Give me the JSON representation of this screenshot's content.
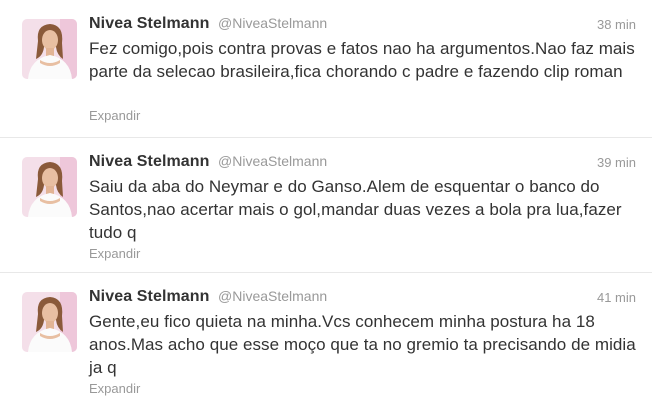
{
  "tweets": [
    {
      "name": "Nivea Stelmann",
      "handle": "@NiveaStelmann",
      "time": "38 min",
      "text": "Fez comigo,pois contra provas e fatos nao ha argumentos.Nao faz mais parte da selecao brasileira,fica chorando c padre e fazendo clip roman",
      "expand": "Expandir"
    },
    {
      "name": "Nivea Stelmann",
      "handle": "@NiveaStelmann",
      "time": "39 min",
      "text": "Saiu da aba do Neymar e do Ganso.Alem de esquentar o banco do Santos,nao acertar mais o gol,mandar duas vezes a bola pra lua,fazer tudo q",
      "expand": "Expandir"
    },
    {
      "name": "Nivea Stelmann",
      "handle": "@NiveaStelmann",
      "time": "41 min",
      "text": "Gente,eu fico quieta na minha.Vcs conhecem minha postura ha 18 anos.Mas acho que esse moço que ta no gremio ta precisando de midia ja q",
      "expand": "Expandir"
    }
  ]
}
